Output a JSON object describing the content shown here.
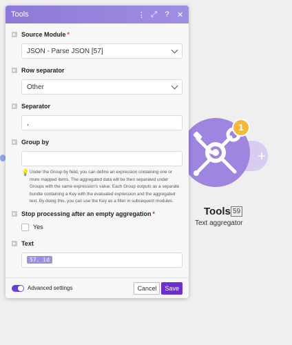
{
  "panel": {
    "title": "Tools",
    "header_icons": [
      "more-vertical-icon",
      "expand-icon",
      "help-icon",
      "close-icon"
    ],
    "fields": {
      "source_module": {
        "label": "Source Module",
        "required": true,
        "value": "JSON - Parse JSON [57]"
      },
      "row_separator": {
        "label": "Row separator",
        "value": "Other"
      },
      "separator": {
        "label": "Separator",
        "value": ","
      },
      "group_by": {
        "label": "Group by",
        "value": "",
        "help": "Under the Group by field, you can define an expression containing one or more mapped items. The aggregated data will be then separated under Groups with the same expression's value. Each Group outputs as a separate bundle containing a Key with the evaluated expression and the aggregated text. By doing this, you can use the Key as a filter in subsequent modules."
      },
      "stop_processing": {
        "label": "Stop processing after an empty aggregation",
        "required": true,
        "option": "Yes"
      },
      "text": {
        "label": "Text",
        "tag": "57. id"
      }
    },
    "footer": {
      "advanced_label": "Advanced settings",
      "advanced_enabled": true,
      "cancel_label": "Cancel",
      "save_label": "Save"
    }
  },
  "module": {
    "name": "Tools",
    "id": "59",
    "type": "Text aggregator",
    "badge": "1",
    "icon": "tools-icon"
  },
  "colors": {
    "header": "#8e79d8",
    "module": "#9d85e0",
    "badge": "#f5b93a",
    "save": "#6b2fd1"
  }
}
